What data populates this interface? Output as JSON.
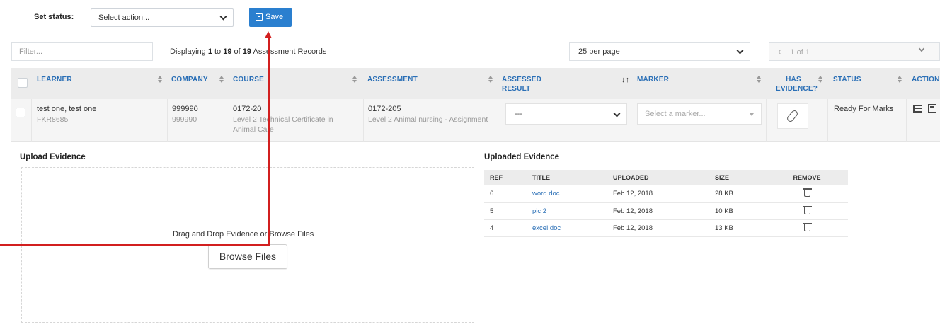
{
  "status_bar": {
    "label": "Set status:",
    "select_value": "Select action...",
    "save_label": "Save"
  },
  "toolbar": {
    "filter_placeholder": "Filter...",
    "displaying_prefix": "Displaying ",
    "displaying_from": "1",
    "displaying_to_word": " to ",
    "displaying_to": "19",
    "displaying_of_word": " of ",
    "displaying_total": "19",
    "displaying_suffix": " Assessment Records",
    "per_page": "25 per page",
    "page_indicator": "1 of 1"
  },
  "table": {
    "headers": {
      "learner": "LEARNER",
      "company": "COMPANY",
      "course": "COURSE",
      "assessment": "ASSESSMENT",
      "assessed_result_1": "ASSESSED",
      "assessed_result_2": "RESULT",
      "marker": "MARKER",
      "has_evidence_1": "HAS",
      "has_evidence_2": "EVIDENCE?",
      "status": "STATUS",
      "action": "ACTION"
    },
    "row": {
      "learner_name": "test one, test one",
      "learner_id": "FKR8685",
      "company_1": "999990",
      "company_2": "999990",
      "course_code": "0172-20",
      "course_name_1": "Level 2 Technical Certificate in",
      "course_name_2": "Animal Care",
      "assessment_code": "0172-205",
      "assessment_name": "Level 2 Animal nursing - Assignment",
      "assessed_result": "---",
      "marker_placeholder": "Select a marker...",
      "status": "Ready For Marks"
    }
  },
  "upload": {
    "title": "Upload Evidence",
    "drop_text": "Drag and Drop Evidence or Browse Files",
    "browse_label": "Browse Files"
  },
  "uploaded": {
    "title": "Uploaded Evidence",
    "headers": {
      "ref": "REF",
      "title": "TITLE",
      "uploaded": "UPLOADED",
      "size": "SIZE",
      "remove": "REMOVE"
    },
    "rows": [
      {
        "ref": "6",
        "title": "word doc",
        "uploaded": "Feb 12, 2018",
        "size": "28 KB"
      },
      {
        "ref": "5",
        "title": "pic 2",
        "uploaded": "Feb 12, 2018",
        "size": "10 KB"
      },
      {
        "ref": "4",
        "title": "excel doc",
        "uploaded": "Feb 12, 2018",
        "size": "13 KB"
      }
    ]
  },
  "colors": {
    "accent": "#2a7fcf",
    "header_link": "#2a6fb6",
    "annotation": "#d21f1f"
  }
}
